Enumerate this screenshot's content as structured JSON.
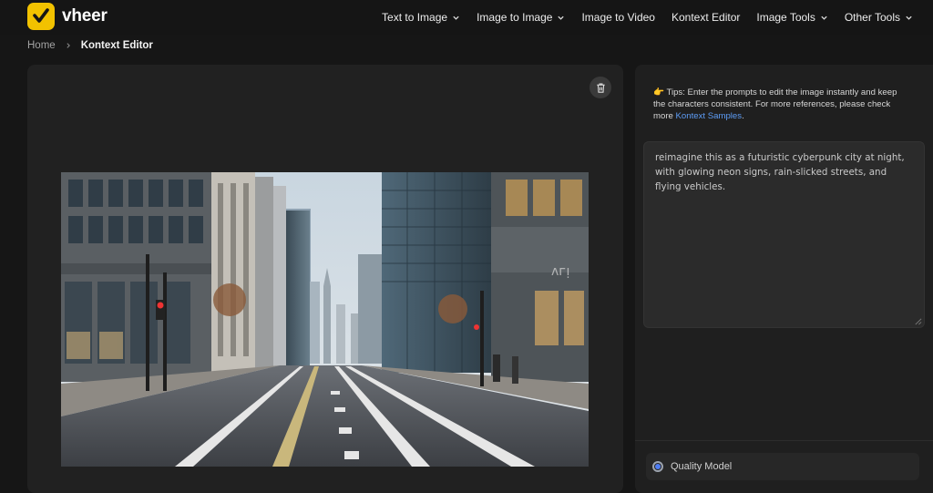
{
  "brand": {
    "name": "vheer"
  },
  "nav": {
    "items": [
      {
        "label": "Text to Image",
        "dropdown": true
      },
      {
        "label": "Image to Image",
        "dropdown": true
      },
      {
        "label": "Image to Video",
        "dropdown": false
      },
      {
        "label": "Kontext Editor",
        "dropdown": false
      },
      {
        "label": "Image Tools",
        "dropdown": true
      },
      {
        "label": "Other Tools",
        "dropdown": true
      }
    ]
  },
  "breadcrumb": {
    "home": "Home",
    "current": "Kontext Editor"
  },
  "tips": {
    "emoji": "👉",
    "text": "Tips: Enter the prompts to edit the image instantly and keep the characters consistent. For more references, please check more ",
    "link": "Kontext Samples",
    "suffix": "."
  },
  "prompt": {
    "value": "reimagine this as a futuristic cyberpunk city at night, with glowing neon signs, rain-slicked streets, and flying vehicles."
  },
  "quality": {
    "label": "Quality Model",
    "selected": true
  },
  "colors": {
    "brand": "#f2c200",
    "link": "#5d9cf5",
    "radio": "#4f7df3"
  },
  "icons": {
    "delete": "trash-icon",
    "chevron": "chevron-down-icon"
  }
}
